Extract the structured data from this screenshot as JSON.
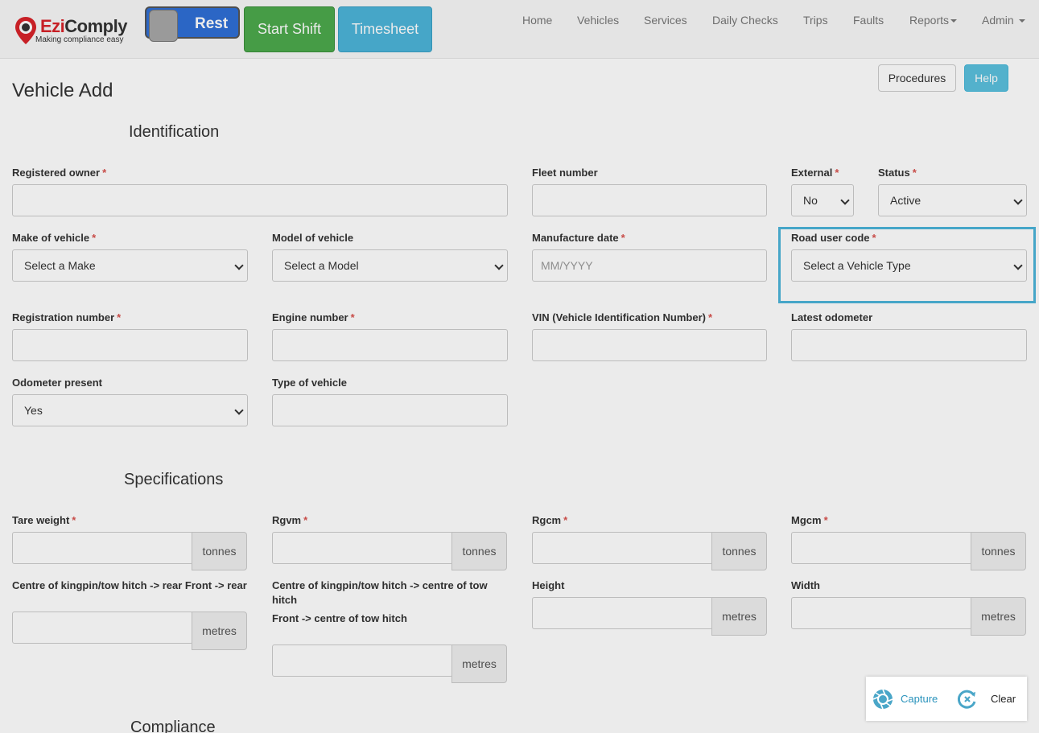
{
  "brand": {
    "name_part1": "Ezi",
    "name_part2": "Comply",
    "tagline": "Making compliance easy"
  },
  "header": {
    "toggle_label": "Rest",
    "start_shift": "Start Shift",
    "timesheet": "Timesheet",
    "nav": [
      "Home",
      "Vehicles",
      "Services",
      "Daily Checks",
      "Trips",
      "Faults",
      "Reports",
      "Admin"
    ]
  },
  "page": {
    "title": "Vehicle Add",
    "procedures": "Procedures",
    "help": "Help"
  },
  "sections": {
    "identification": "Identification",
    "specifications": "Specifications",
    "compliance": "Compliance"
  },
  "identification": {
    "registered_owner": "Registered owner",
    "fleet_number": "Fleet number",
    "external": "External",
    "external_value": "No",
    "status": "Status",
    "status_value": "Active",
    "make": "Make of vehicle",
    "make_value": "Select a Make",
    "model": "Model of vehicle",
    "model_value": "Select a Model",
    "manufacture_date": "Manufacture date",
    "manufacture_placeholder": "MM/YYYY",
    "road_user_code": "Road user code",
    "road_user_value": "Select a Vehicle Type",
    "registration": "Registration number",
    "engine": "Engine number",
    "vin": "VIN (Vehicle Identification Number)",
    "odometer": "Latest odometer",
    "odometer_present": "Odometer present",
    "odometer_present_value": "Yes",
    "type_of_vehicle": "Type of vehicle"
  },
  "specifications": {
    "tare": "Tare weight",
    "rgvm": "Rgvm",
    "rgcm": "Rgcm",
    "mgcm": "Mgcm",
    "tonnes": "tonnes",
    "metres": "metres",
    "kingpin_rear": "Centre of kingpin/tow hitch -> rear Front -> rear",
    "kingpin_tow": "Centre of kingpin/tow hitch -> centre of tow hitch",
    "front_tow": "Front -> centre of tow hitch",
    "height": "Height",
    "width": "Width"
  },
  "capture": {
    "capture": "Capture",
    "clear": "Clear"
  },
  "req_mark": "*"
}
